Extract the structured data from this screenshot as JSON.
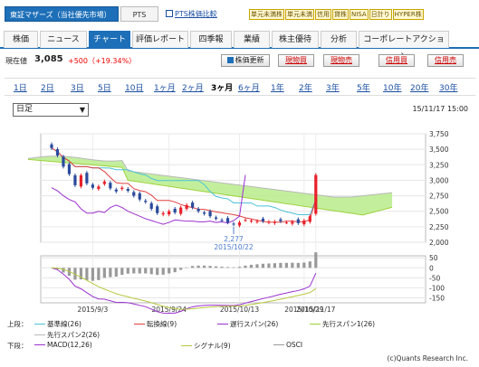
{
  "header": {
    "market_tab": "東証マザーズ（当社優先市場）",
    "pts_tab": "PTS",
    "pts_compare_link": "PTS株価比較",
    "badges": [
      "単元未満株",
      "単元未満",
      "信用",
      "貸株",
      "NISA",
      "日計り",
      "HYPER株"
    ]
  },
  "nav": {
    "tabs": [
      "株価",
      "ニュース",
      "チャート",
      "評価レポート",
      "四季報",
      "業績",
      "株主優待",
      "分析",
      "コーポレートアクション"
    ],
    "active": "チャート"
  },
  "price": {
    "label": "現在値",
    "value": "3,085",
    "change": "+500（+19.34%）",
    "refresh_button": "株価更新",
    "buy_button": "現物買",
    "sell_button": "現物売",
    "margin_buy_button": "信用買",
    "margin_sell_button": "信用売"
  },
  "periods": {
    "items": [
      "1日",
      "2日",
      "3日",
      "5日",
      "10日",
      "1ヶ月",
      "2ヶ月",
      "3ヶ月",
      "6ヶ月",
      "1年",
      "2年",
      "3年",
      "5年",
      "10年",
      "20年",
      "30年"
    ],
    "active": "3ヶ月"
  },
  "candle_select": {
    "value": "日足"
  },
  "datetime": "15/11/17 15:00",
  "chart_data": [
    {
      "type": "candlestick",
      "title": "",
      "x": [
        "2015/9/3",
        "2015/9/24",
        "2015/10/13",
        "2015/10/29",
        "2015/11/17"
      ],
      "ylim": [
        2000,
        3750
      ],
      "yticks": [
        "3,750",
        "3,500",
        "3,250",
        "3,000",
        "2,750",
        "2,500",
        "2,250",
        "2,000"
      ],
      "close": [
        3520,
        3400,
        3220,
        3100,
        2920,
        3080,
        2950,
        2880,
        2900,
        2980,
        2870,
        2820,
        2880,
        2830,
        2750,
        2690,
        2650,
        2540,
        2470,
        2470,
        2500,
        2480,
        2560,
        2600,
        2560,
        2500,
        2460,
        2420,
        2380,
        2350,
        2320,
        2290,
        2320,
        2360,
        2350,
        2340,
        2340,
        2330,
        2330,
        2340,
        2320,
        2330,
        2310,
        2350,
        2420,
        3085
      ],
      "annotations": [
        {
          "label": "2,277",
          "date": "2015/10/22"
        }
      ],
      "series": [
        {
          "name": "基準線(26)"
        },
        {
          "name": "転換線(9)"
        },
        {
          "name": "遅行スパン(26)"
        },
        {
          "name": "先行スパン1(26)"
        },
        {
          "name": "先行スパン2(26)"
        }
      ]
    },
    {
      "type": "bar",
      "title": "",
      "x": [
        "2015/9/3",
        "2015/9/24",
        "2015/10/13",
        "2015/10/29",
        "2015/11/17"
      ],
      "ylim": [
        -175,
        60
      ],
      "yticks": [
        "50",
        "0",
        "-50",
        "-100",
        "-150"
      ],
      "series": [
        {
          "name": "MACD(12,26)"
        },
        {
          "name": "シグナル(9)"
        },
        {
          "name": "OSCI"
        }
      ]
    }
  ],
  "legend": {
    "upper_label": "上段：",
    "lower_label": "下段：",
    "upper": [
      "基準線(26)",
      "転換線(9)",
      "遅行スパン(26)",
      "先行スパン1(26)",
      "先行スパン2(26)"
    ],
    "lower": [
      "MACD(12,26)",
      "シグナル(9)",
      "OSCI"
    ],
    "colors": {
      "kijun": "#4cc3d8",
      "tenkan": "#e04040",
      "chikou": "#9b30d0",
      "span1": "#9ed23a",
      "span2": "#b8b8b8",
      "macd": "#9b30d0",
      "signal": "#b8c840",
      "osci": "#999999",
      "up": "#e8202a",
      "down": "#2a4a9c",
      "cloud": "#b8ec8c"
    }
  },
  "copyright": "(c)Quants Research Inc."
}
